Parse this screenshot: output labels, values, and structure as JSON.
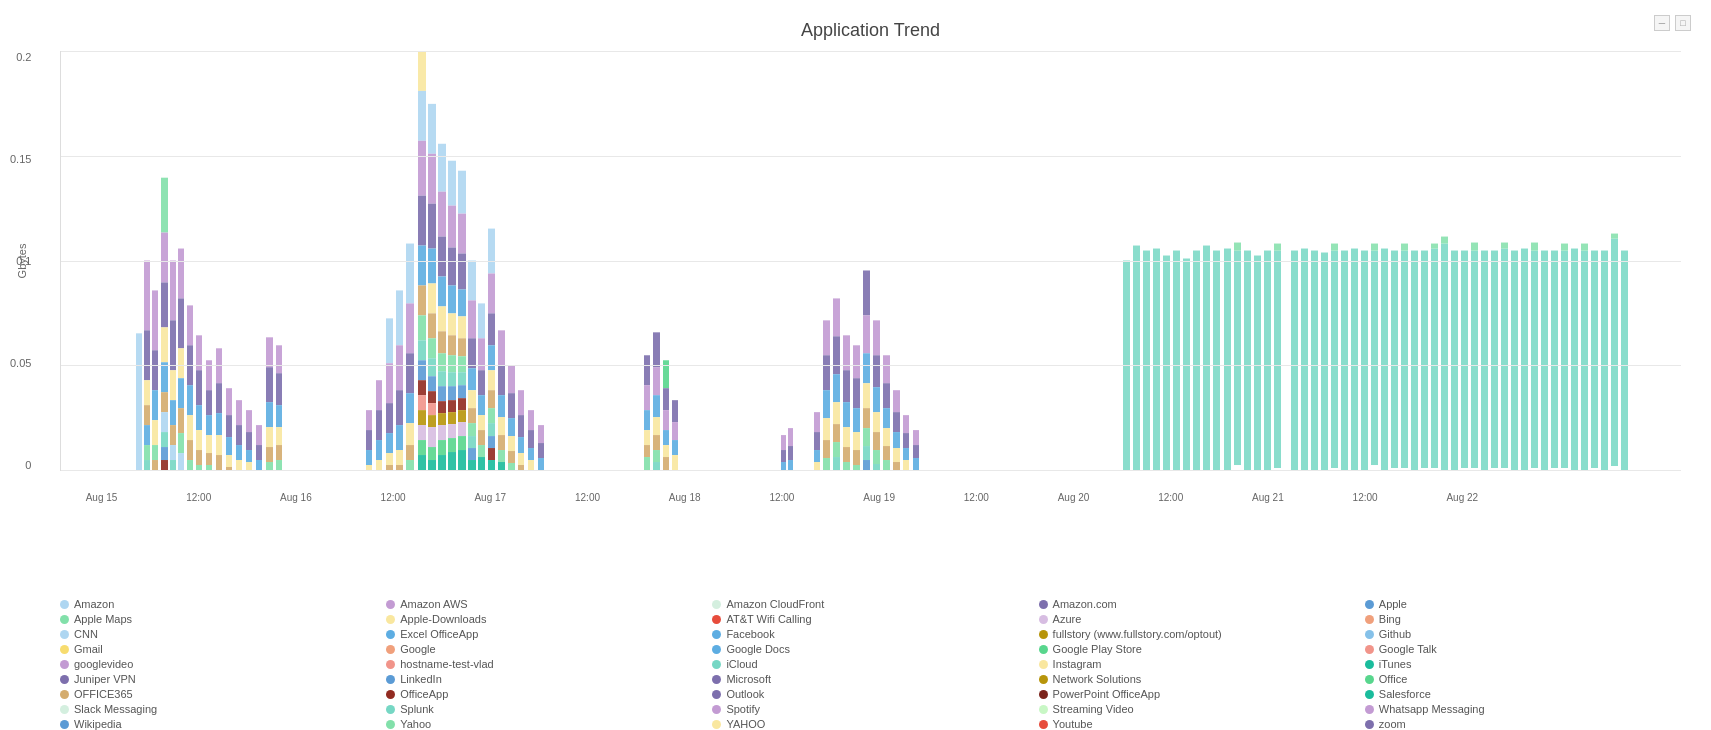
{
  "title": "Application Trend",
  "y_axis": {
    "label": "Gbytes",
    "ticks": [
      "0.2",
      "0.15",
      "0.1",
      "0.05",
      "0"
    ]
  },
  "x_axis": {
    "labels": [
      {
        "text": "Aug 15",
        "pct": 2.5
      },
      {
        "text": "12:00",
        "pct": 8.5
      },
      {
        "text": "Aug 16",
        "pct": 14.5
      },
      {
        "text": "12:00",
        "pct": 20.5
      },
      {
        "text": "Aug 17",
        "pct": 26.5
      },
      {
        "text": "12:00",
        "pct": 32.5
      },
      {
        "text": "Aug 18",
        "pct": 38.5
      },
      {
        "text": "12:00",
        "pct": 44.5
      },
      {
        "text": "Aug 19",
        "pct": 50.5
      },
      {
        "text": "12:00",
        "pct": 56.5
      },
      {
        "text": "Aug 20",
        "pct": 62.5
      },
      {
        "text": "12:00",
        "pct": 68.5
      },
      {
        "text": "Aug 21",
        "pct": 74.5
      },
      {
        "text": "12:00",
        "pct": 80.5
      },
      {
        "text": "Aug 22",
        "pct": 86.5
      }
    ]
  },
  "legend": [
    {
      "label": "Amazon",
      "color": "#aed6f1"
    },
    {
      "label": "Amazon AWS",
      "color": "#c39bd3"
    },
    {
      "label": "Amazon CloudFront",
      "color": "#d4efdf"
    },
    {
      "label": "Amazon.com",
      "color": "#7d6fad"
    },
    {
      "label": "Apple",
      "color": "#5b9bd5"
    },
    {
      "label": "Apple Maps",
      "color": "#82e0aa"
    },
    {
      "label": "Apple-Downloads",
      "color": "#f9e79f"
    },
    {
      "label": "AT&T Wifi Calling",
      "color": "#e74c3c"
    },
    {
      "label": "Azure",
      "color": "#d7bde2"
    },
    {
      "label": "Bing",
      "color": "#f0a07c"
    },
    {
      "label": "CNN",
      "color": "#aed6f1"
    },
    {
      "label": "Excel OfficeApp",
      "color": "#5dade2"
    },
    {
      "label": "Facebook",
      "color": "#5dade2"
    },
    {
      "label": "fullstory (www.fullstory.com/optout)",
      "color": "#b7950b"
    },
    {
      "label": "Github",
      "color": "#85c1e9"
    },
    {
      "label": "Gmail",
      "color": "#f7dc6f"
    },
    {
      "label": "Google",
      "color": "#f0a07c"
    },
    {
      "label": "Google Docs",
      "color": "#5dade2"
    },
    {
      "label": "Google Play Store",
      "color": "#58d68d"
    },
    {
      "label": "Google Talk",
      "color": "#f1948a"
    },
    {
      "label": "googlevideo",
      "color": "#c39bd3"
    },
    {
      "label": "hostname-test-vlad",
      "color": "#f1948a"
    },
    {
      "label": "iCloud",
      "color": "#76d7c4"
    },
    {
      "label": "Instagram",
      "color": "#f9e79f"
    },
    {
      "label": "iTunes",
      "color": "#1abc9c"
    },
    {
      "label": "Juniper VPN",
      "color": "#7d6fad"
    },
    {
      "label": "LinkedIn",
      "color": "#5b9bd5"
    },
    {
      "label": "Microsoft",
      "color": "#7d6fad"
    },
    {
      "label": "Network Solutions",
      "color": "#b7950b"
    },
    {
      "label": "Office",
      "color": "#58d68d"
    },
    {
      "label": "OFFICE365",
      "color": "#d4ac6e"
    },
    {
      "label": "OfficeApp",
      "color": "#922b21"
    },
    {
      "label": "Outlook",
      "color": "#7d6fad"
    },
    {
      "label": "PowerPoint OfficeApp",
      "color": "#7b241c"
    },
    {
      "label": "Salesforce",
      "color": "#1abc9c"
    },
    {
      "label": "Slack Messaging",
      "color": "#d4efdf"
    },
    {
      "label": "Splunk",
      "color": "#76d7c4"
    },
    {
      "label": "Spotify",
      "color": "#c39bd3"
    },
    {
      "label": "Streaming Video",
      "color": "#c8f7c5"
    },
    {
      "label": "Whatsapp Messaging",
      "color": "#c39bd3"
    },
    {
      "label": "Wikipedia",
      "color": "#5b9bd5"
    },
    {
      "label": "Yahoo",
      "color": "#82e0aa"
    },
    {
      "label": "YAHOO",
      "color": "#f9e79f"
    },
    {
      "label": "Youtube",
      "color": "#e74c3c"
    },
    {
      "label": "zoom",
      "color": "#7d6fad"
    }
  ],
  "controls": {
    "minimize": "─",
    "maximize": "□"
  }
}
